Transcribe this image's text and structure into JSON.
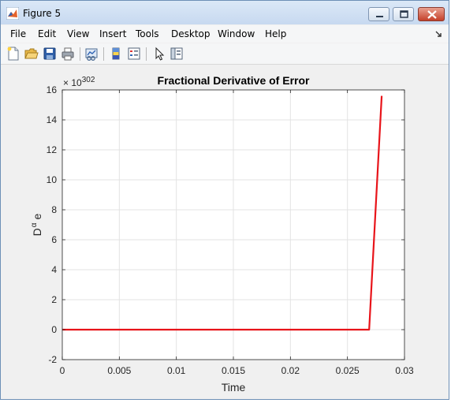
{
  "window": {
    "title": "Figure 5",
    "controls": [
      "minimize-button",
      "maximize-button",
      "close-button"
    ]
  },
  "menu": {
    "items": [
      "File",
      "Edit",
      "View",
      "Insert",
      "Tools",
      "Desktop",
      "Window",
      "Help"
    ]
  },
  "toolbar": {
    "icons": [
      "new-figure-icon",
      "open-file-icon",
      "save-icon",
      "print-icon",
      "link-plot-icon",
      "insert-colorbar-icon",
      "insert-legend-icon",
      "edit-plot-arrow-icon",
      "show-plot-tools-icon"
    ]
  },
  "chart_data": {
    "type": "line",
    "title": "Fractional Derivative of Error",
    "xlabel": "Time",
    "ylabel": "D",
    "ylabel_superscript": "α",
    "ylabel_suffix": "e",
    "y_exponent_base": "× 10",
    "y_exponent": "302",
    "xlim": [
      0,
      0.03
    ],
    "ylim": [
      -2,
      16
    ],
    "x_ticks": [
      0,
      0.005,
      0.01,
      0.015,
      0.02,
      0.025,
      0.03
    ],
    "x_tick_labels": [
      "0",
      "0.005",
      "0.01",
      "0.015",
      "0.02",
      "0.025",
      "0.03"
    ],
    "y_ticks": [
      -2,
      0,
      2,
      4,
      6,
      8,
      10,
      12,
      14,
      16
    ],
    "y_tick_labels": [
      "-2",
      "0",
      "2",
      "4",
      "6",
      "8",
      "10",
      "12",
      "14",
      "16"
    ],
    "grid": true,
    "series": [
      {
        "color": "#e8141a",
        "x": [
          0,
          0.005,
          0.01,
          0.015,
          0.02,
          0.025,
          0.0269,
          0.028
        ],
        "y": [
          0,
          0,
          0,
          0,
          0,
          0,
          0,
          15.6
        ]
      }
    ]
  }
}
